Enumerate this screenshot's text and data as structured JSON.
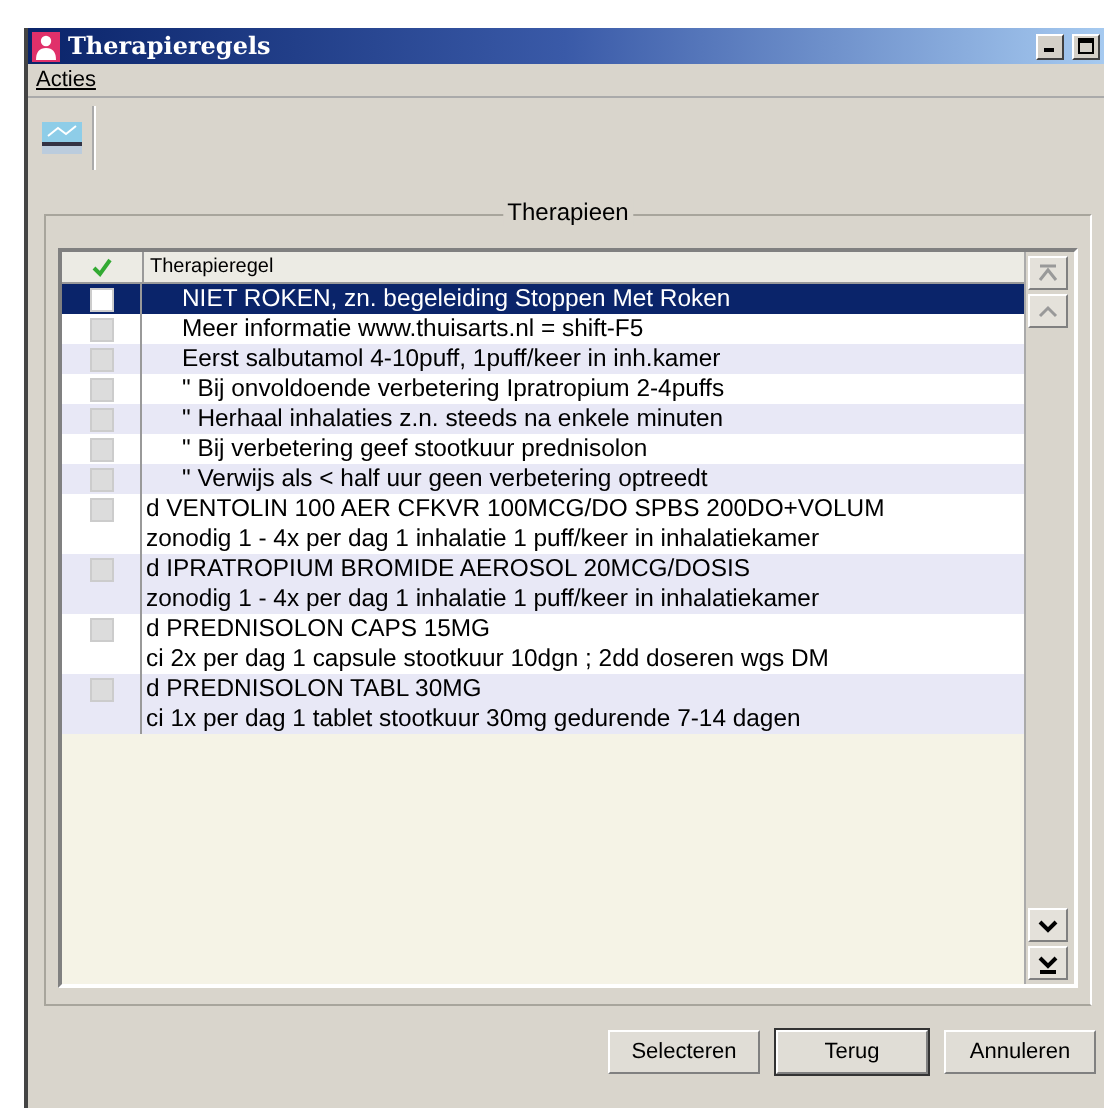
{
  "window": {
    "title": "Therapieregels"
  },
  "menu": [
    "Acties"
  ],
  "group": {
    "title": "Therapieen"
  },
  "table": {
    "columns": [
      "Therapieregel"
    ],
    "rows": [
      {
        "lines": [
          "NIET ROKEN, zn. begeleiding Stoppen Met Roken"
        ],
        "indented": true,
        "selected": true,
        "checked": false
      },
      {
        "lines": [
          "Meer informatie www.thuisarts.nl = shift-F5"
        ],
        "indented": true,
        "selected": false,
        "checked": false
      },
      {
        "lines": [
          "Eerst salbutamol 4-10puff, 1puff/keer in inh.kamer"
        ],
        "indented": true,
        "selected": false,
        "checked": false
      },
      {
        "lines": [
          "\" Bij onvoldoende verbetering Ipratropium 2-4puffs"
        ],
        "indented": true,
        "selected": false,
        "checked": false
      },
      {
        "lines": [
          "\" Herhaal inhalaties z.n. steeds na enkele minuten"
        ],
        "indented": true,
        "selected": false,
        "checked": false
      },
      {
        "lines": [
          "\" Bij verbetering geef stootkuur prednisolon"
        ],
        "indented": true,
        "selected": false,
        "checked": false
      },
      {
        "lines": [
          "\" Verwijs als < half uur geen verbetering optreedt"
        ],
        "indented": true,
        "selected": false,
        "checked": false
      },
      {
        "lines": [
          "d VENTOLIN 100 AER CFKVR 100MCG/DO SPBS 200DO+VOLUM",
          "zonodig 1 - 4x per dag 1 inhalatie 1 puff/keer in inhalatiekamer"
        ],
        "indented": false,
        "selected": false,
        "checked": false
      },
      {
        "lines": [
          "d IPRATROPIUM BROMIDE AEROSOL 20MCG/DOSIS",
          "zonodig 1 - 4x per dag 1 inhalatie 1 puff/keer in inhalatiekamer"
        ],
        "indented": false,
        "selected": false,
        "checked": false
      },
      {
        "lines": [
          "d PREDNISOLON CAPS 15MG",
          "ci 2x per dag 1 capsule stootkuur 10dgn ; 2dd doseren wgs DM"
        ],
        "indented": false,
        "selected": false,
        "checked": false
      },
      {
        "lines": [
          "d PREDNISOLON TABL 30MG",
          "ci 1x per dag 1 tablet stootkuur 30mg gedurende 7-14 dagen"
        ],
        "indented": false,
        "selected": false,
        "checked": false
      }
    ]
  },
  "buttons": [
    "Selecteren",
    "Terug",
    "Annuleren"
  ]
}
